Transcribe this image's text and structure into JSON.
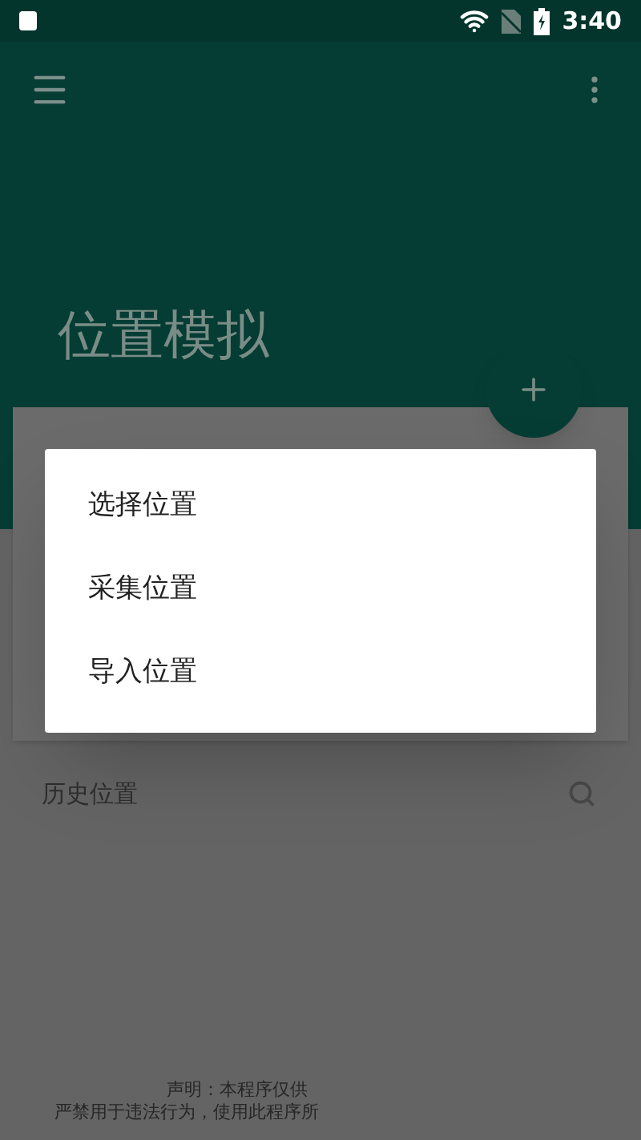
{
  "status_bar": {
    "time": "3:40"
  },
  "toolbar": {
    "title": "位置模拟"
  },
  "history": {
    "title": "历史位置"
  },
  "menu": {
    "items": [
      "选择位置",
      "采集位置",
      "导入位置"
    ]
  },
  "footer": {
    "lines": [
      "声明：本程序仅供",
      "严禁用于违法行为，使用此程序所"
    ]
  }
}
